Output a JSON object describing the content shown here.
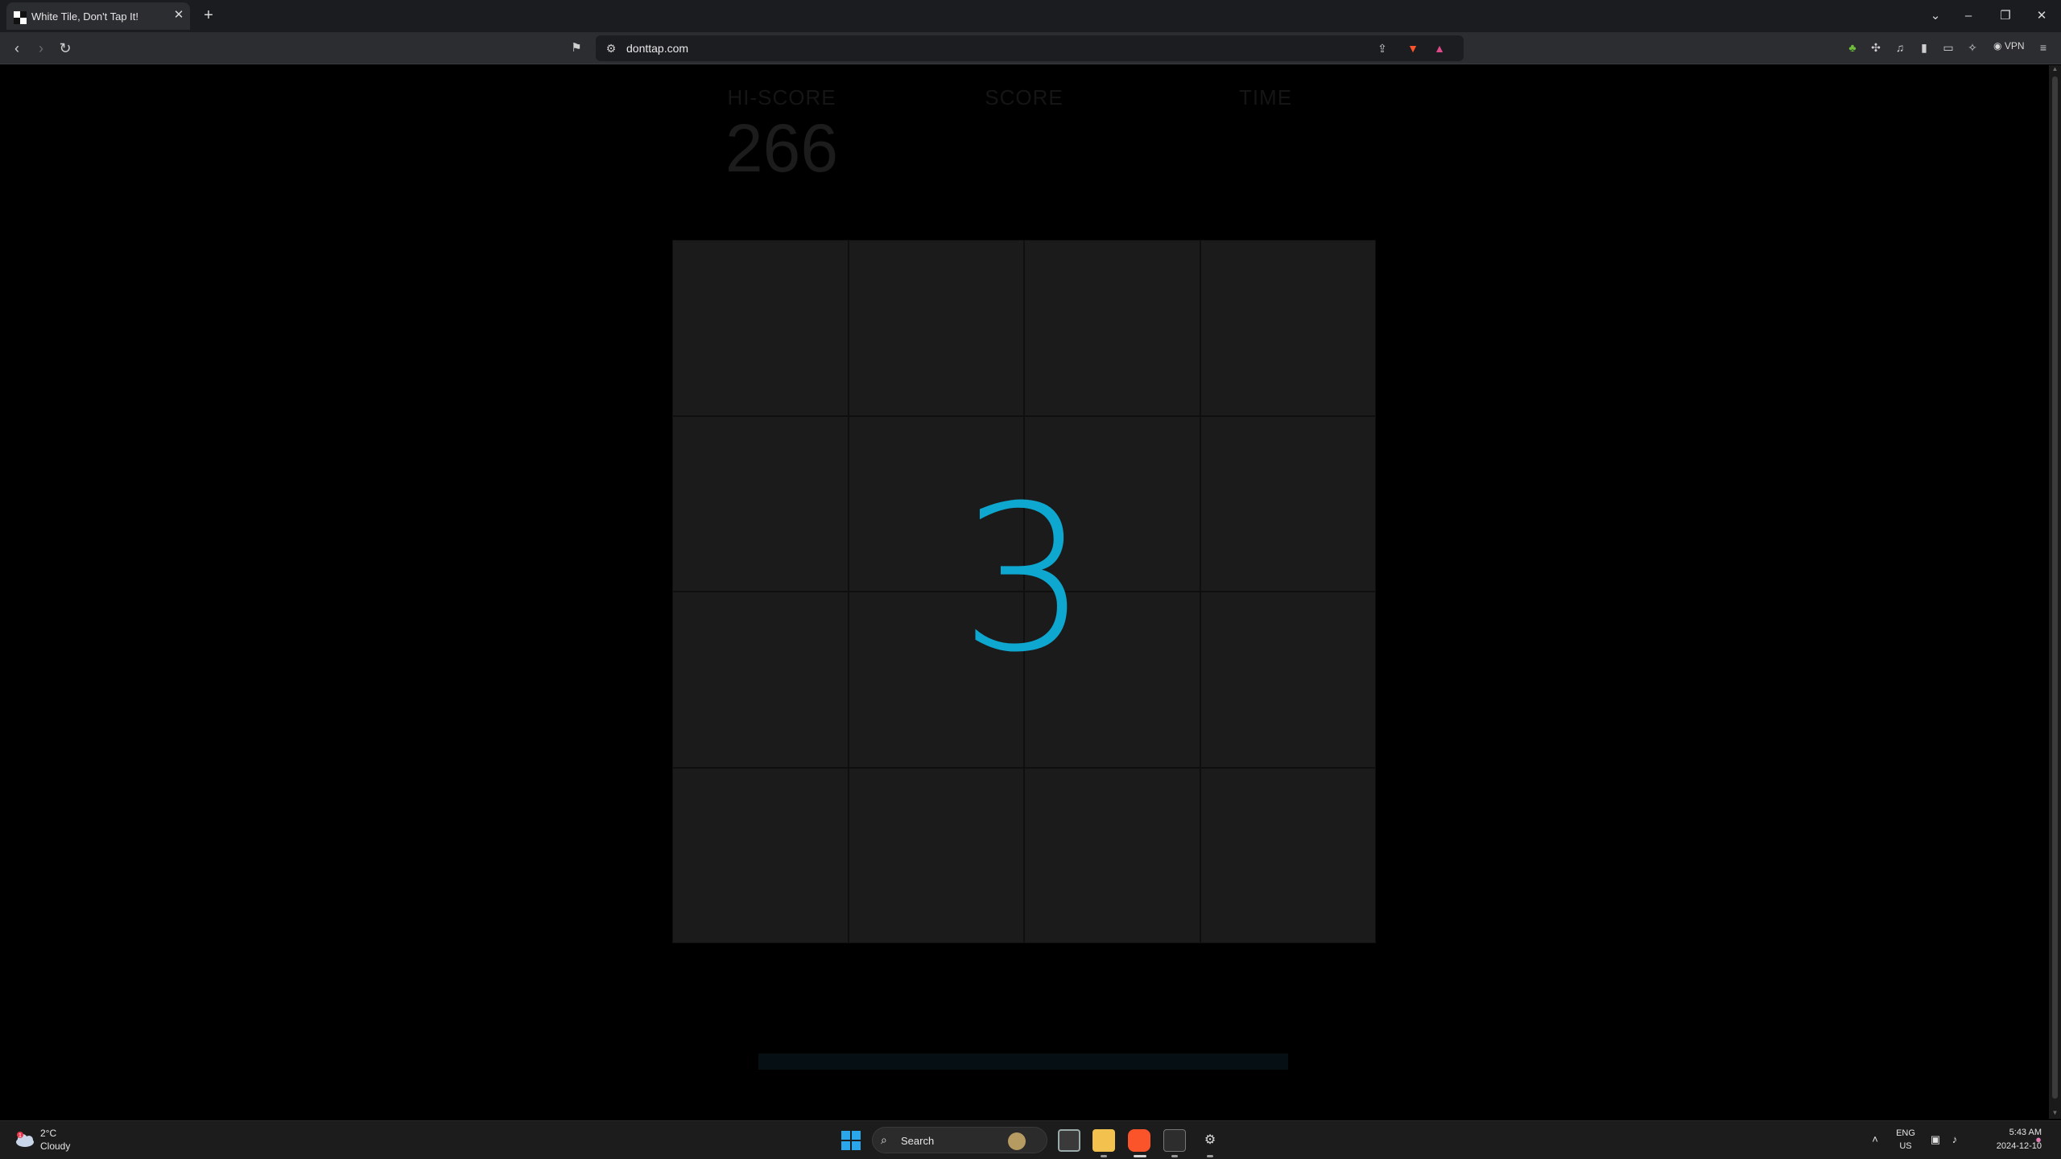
{
  "browser": {
    "tab_title": "White Tile, Don't Tap It!",
    "url": "donttap.com",
    "vpn_label": "VPN"
  },
  "game": {
    "hiscore_label": "HI-SCORE",
    "hiscore_value": "266",
    "score_label": "SCORE",
    "time_label": "TIME",
    "countdown": "3",
    "grid_rows": 4,
    "grid_cols": 4,
    "countdown_color": "#0ea7cf"
  },
  "taskbar": {
    "temperature": "2°C",
    "condition": "Cloudy",
    "weather_badge": "1",
    "search_placeholder": "Search",
    "language": "ENG",
    "region": "US",
    "time": "5:43 AM",
    "date": "2024-12-10"
  }
}
